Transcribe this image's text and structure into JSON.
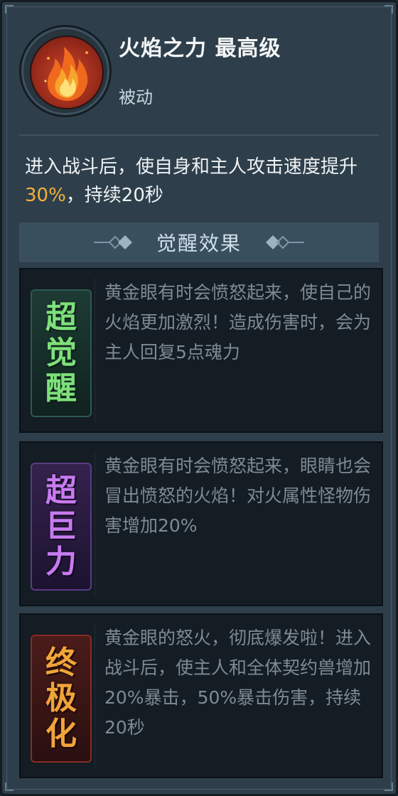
{
  "skill": {
    "name": "火焰之力 最高级",
    "type": "被动",
    "icon": "fire-icon",
    "description_before": "进入战斗后，使自身和主人攻击速度提升",
    "description_highlight": "30%",
    "description_after": "，持续20秒",
    "highlight_color": "#f2b13a"
  },
  "awaken": {
    "title": "觉醒效果",
    "effects": [
      {
        "badge": [
          "超",
          "觉",
          "醒"
        ],
        "badge_color": "#7ee07a",
        "text": "黄金眼有时会愤怒起来，使自己的火焰更加激烈！造成伤害时，会为主人回复5点魂力"
      },
      {
        "badge": [
          "超",
          "巨",
          "力"
        ],
        "badge_color": "#c77bf0",
        "text": "黄金眼有时会愤怒起来，眼睛也会冒出愤怒的火焰！对火属性怪物伤害增加20%"
      },
      {
        "badge": [
          "终",
          "极",
          "化"
        ],
        "badge_color": "#f0a53a",
        "text": "黄金眼的怒火，彻底爆发啦！进入战斗后，使主人和全体契约兽增加20%暴击，50%暴击伤害，持续20秒"
      }
    ]
  }
}
